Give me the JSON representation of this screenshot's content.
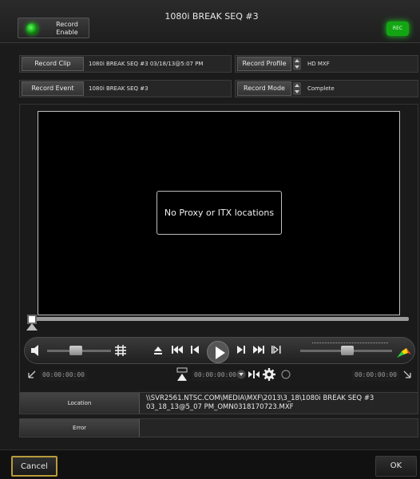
{
  "header": {
    "record_enable_label": "Record Enable",
    "title": "1080i BREAK SEQ #3",
    "rec_badge": "REC"
  },
  "info": {
    "record_clip_label": "Record Clip",
    "record_clip_value": "1080i BREAK SEQ #3 03/18/13@5:07 PM",
    "record_profile_label": "Record Profile",
    "record_profile_value": "HD MXF",
    "record_event_label": "Record Event",
    "record_event_value": "1080i BREAK SEQ #3",
    "record_mode_label": "Record Mode",
    "record_mode_value": "Complete"
  },
  "player": {
    "message": "No Proxy or ITX locations",
    "mark_in_tc": "00:00:00:00",
    "current_tc": "00:00:00:00",
    "mark_out_tc": "00:00:00:00"
  },
  "location": {
    "label": "Location",
    "value": "\\\\SVR2561.NTSC.COM\\MEDIA\\MXF\\2013\\3_18\\1080i BREAK SEQ #3 03_18_13@5_07 PM_OMN0318170723.MXF"
  },
  "error": {
    "label": "Error",
    "value": ""
  },
  "footer": {
    "cancel_label": "Cancel",
    "ok_label": "OK"
  },
  "colors": {
    "led_green": "#13a613",
    "focus_outline": "#b89b3a"
  }
}
